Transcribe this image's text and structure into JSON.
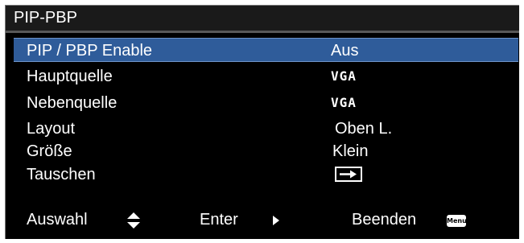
{
  "title": "PIP-PBP",
  "rows": [
    {
      "label": "PIP / PBP Enable",
      "value": "Aus"
    },
    {
      "label": "Hauptquelle",
      "value": "VGA"
    },
    {
      "label": "Nebenquelle",
      "value": "VGA"
    },
    {
      "label": "Layout",
      "value": "Oben L."
    },
    {
      "label": "Größe",
      "value": "Klein"
    },
    {
      "label": "Tauschen",
      "icon": "swap-arrow-icon"
    }
  ],
  "footer": {
    "select_label": "Auswahl",
    "select_icon": "up-down-arrows-icon",
    "enter_label": "Enter",
    "enter_icon": "right-triangle-icon",
    "exit_label": "Beenden",
    "exit_icon": "menu-button-icon",
    "menu_badge": "Menu"
  },
  "colors": {
    "background": "#000000",
    "selected_row": "#2f5c9a",
    "text": "#ffffff"
  }
}
